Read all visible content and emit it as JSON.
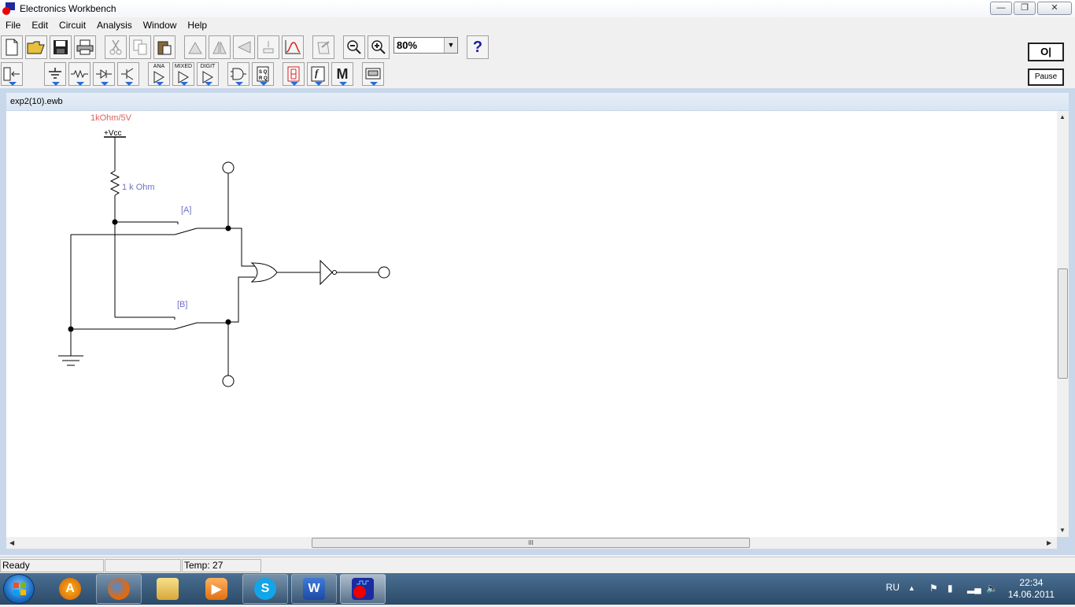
{
  "window": {
    "title": "Electronics Workbench"
  },
  "menu": [
    "File",
    "Edit",
    "Circuit",
    "Analysis",
    "Window",
    "Help"
  ],
  "toolbar": {
    "zoom_value": "80%",
    "help_symbol": "?",
    "power_label": "O|",
    "pause_label": "Pause"
  },
  "parts_bin": {
    "analog_ics_label": "ANA",
    "mixed_ics_label": "MIXED",
    "digital_ics_label": "DIGIT",
    "miscellaneous_label": "M",
    "functions_label": "f"
  },
  "document": {
    "title": "exp2(10).ewb"
  },
  "circuit": {
    "vcc_label": "+Vcc",
    "vcc_value": "1kOhm/5V",
    "resistor_label": "1 k Ohm",
    "switch_a_label": "[A]",
    "switch_b_label": "[B]"
  },
  "scrollbar": {
    "grip": "III"
  },
  "status": {
    "message": "Ready",
    "temp_label": "Temp:",
    "temp_value": "27"
  },
  "taskbar": {
    "lang": "RU",
    "time": "22:34",
    "date": "14.06.2011"
  },
  "colors": {
    "component_label_red": "#e06060",
    "component_label_blue": "#7070c8",
    "canvas_bg": "#ffffff"
  }
}
